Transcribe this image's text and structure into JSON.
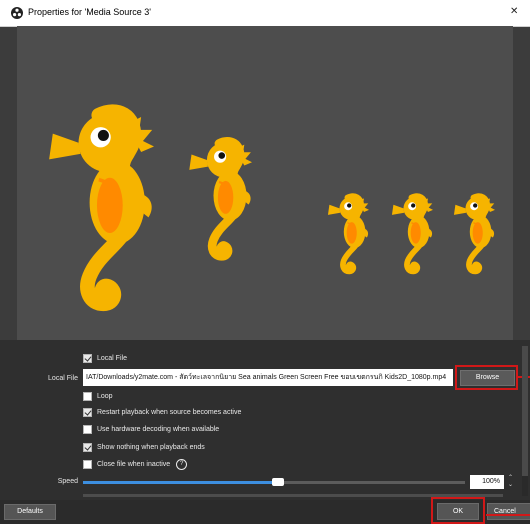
{
  "window": {
    "title": "Properties for 'Media Source 3'",
    "close_glyph": "✕",
    "app_icon": "obs-logo-icon"
  },
  "properties": {
    "local_file_checkbox": {
      "label": "Local File",
      "checked": true
    },
    "local_file_row_label": "Local File",
    "local_file_path": "IAT/Downloads/y2mate.com - สัตว์ทะเลจากนิยาย Sea animals Green Screen Free  ขอบเขตกรนกิ Kids2D_1080p.mp4",
    "browse_label": "Browse",
    "loop": {
      "label": "Loop",
      "checked": false
    },
    "restart_playback": {
      "label": "Restart playback when source becomes active",
      "checked": true
    },
    "hardware_decoding": {
      "label": "Use hardware decoding when available",
      "checked": false
    },
    "show_nothing": {
      "label": "Show nothing when playback ends",
      "checked": true
    },
    "close_file": {
      "label": "Close file when inactive",
      "checked": false,
      "help_glyph": "?"
    },
    "speed_label": "Speed",
    "speed_value": "100%",
    "speed_fraction": 0.51,
    "spin_up_glyph": "⌃",
    "spin_down_glyph": "⌄"
  },
  "footer": {
    "defaults_label": "Defaults",
    "ok_label": "OK",
    "cancel_label": "Cancel"
  },
  "colors": {
    "highlight": "#d11818",
    "accent": "#3d8fe0",
    "seahorse_body": "#f6b400",
    "seahorse_belly": "#ff8a00"
  }
}
